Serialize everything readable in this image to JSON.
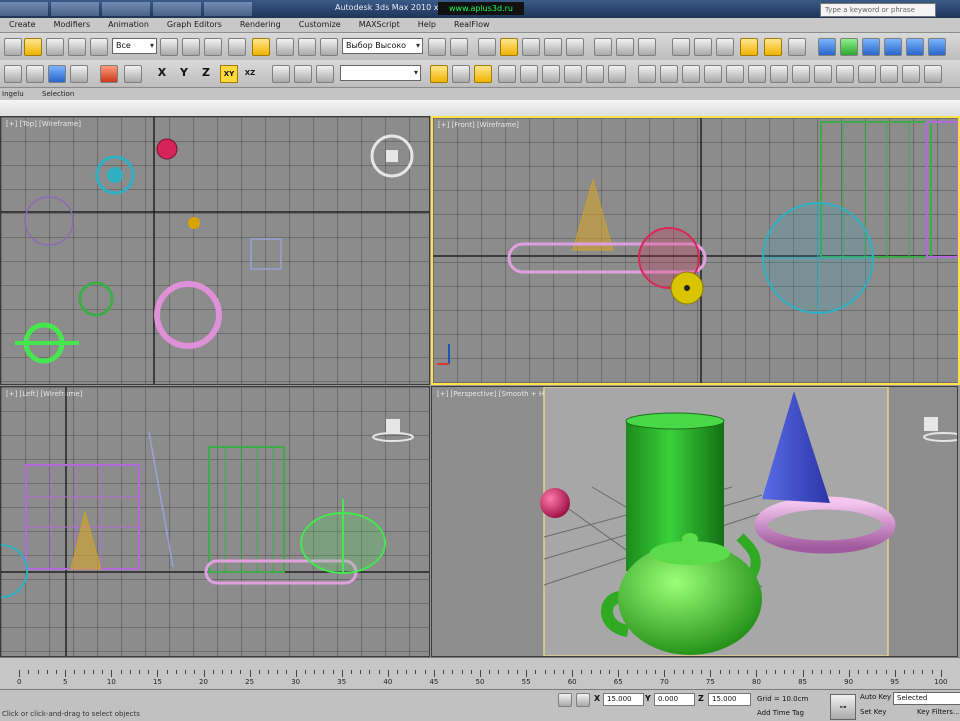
{
  "window": {
    "title": "Autodesk 3ds Max  2010 x64",
    "watermark": "www.aplus3d.ru",
    "search_placeholder": "Type a keyword or phrase"
  },
  "menu": [
    "Create",
    "Modifiers",
    "Animation",
    "Graph Editors",
    "Rendering",
    "Customize",
    "MAXScript",
    "Help",
    "RealFlow"
  ],
  "toolbar": {
    "filter_value": "Все",
    "named_selection": "Выбор Высоко"
  },
  "axis_buttons": [
    "X",
    "Y",
    "Z",
    "XY",
    "XZ"
  ],
  "ribbon": {
    "left_label": "Ingelu",
    "selection_label": "Selection"
  },
  "viewports": {
    "top": {
      "label": "[+] [Top] [Wireframe]"
    },
    "front": {
      "label": "[+] [Front] [Wireframe]"
    },
    "left": {
      "label": "[+] [Left] [Wireframe]"
    },
    "perspective": {
      "label": "[+] [Perspective] [Smooth + Highlights + Edged Faces]"
    }
  },
  "timeline": {
    "ticks": [
      "0",
      "5",
      "10",
      "15",
      "20",
      "25",
      "30",
      "35",
      "40",
      "45",
      "50",
      "55",
      "60",
      "65",
      "70",
      "75",
      "80",
      "85",
      "90",
      "95",
      "100"
    ]
  },
  "status": {
    "prompt": "Click or click-and-drag to select objects",
    "x_value": "15.000",
    "y_value": "0.000",
    "z_value": "15.000",
    "grid": "Grid = 10.0cm",
    "add_time_tag": "Add Time Tag",
    "auto_key": "Auto Key",
    "set_key": "Set Key",
    "selected": "Selected",
    "key_filters": "Key Filters..."
  },
  "colors": {
    "active_viewport_border": "#ffe04a",
    "highlight_button": "#ffd83a",
    "viewport_bg": "#8c8c8c"
  }
}
